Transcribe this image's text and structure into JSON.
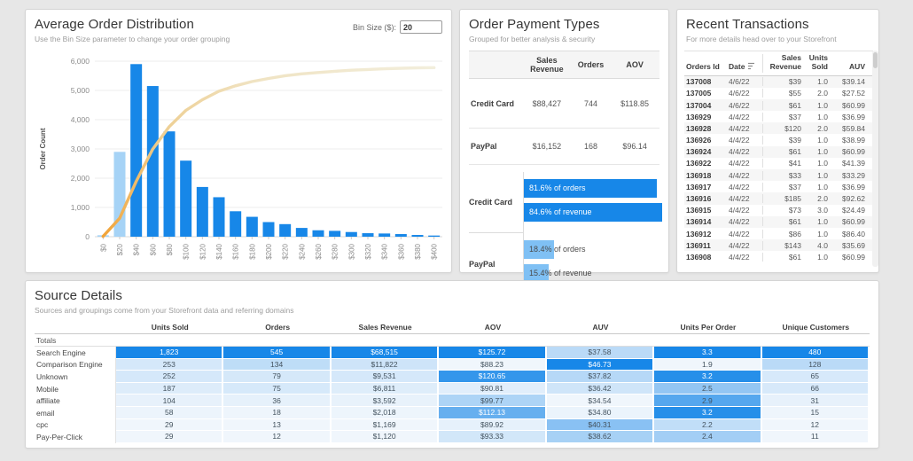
{
  "colors": {
    "bar_blue": "#1787e8",
    "bar_blue_light": "#a6d3f6",
    "paypal_blue": "#7fc0f4",
    "heat_low": "#f0f6fc",
    "heat_high": "#1787e8",
    "line_gradient": [
      "#f1a338",
      "#eecf93",
      "#f0e3c2",
      "#f2eedc"
    ]
  },
  "chart_data": [
    {
      "type": "bar",
      "subtype": "pareto-histogram-with-cumulative-line",
      "title": "Average Order Distribution",
      "ylabel": "Order Count",
      "ylim": [
        0,
        6000
      ],
      "y_ticks": [
        "0",
        "1,000",
        "2,000",
        "3,000",
        "4,000",
        "5,000",
        "6,000"
      ],
      "categories": [
        "$0",
        "$20",
        "$40",
        "$60",
        "$80",
        "$100",
        "$120",
        "$140",
        "$160",
        "$180",
        "$200",
        "$220",
        "$240",
        "$260",
        "$280",
        "$300",
        "$320",
        "$340",
        "$360",
        "$380",
        "$400"
      ],
      "values": [
        50,
        2900,
        5900,
        5150,
        3600,
        2600,
        1700,
        1350,
        870,
        680,
        500,
        430,
        300,
        220,
        200,
        160,
        120,
        110,
        90,
        60,
        40
      ],
      "light_bins": [
        0,
        20
      ],
      "line": {
        "name": "cumulative share of orders",
        "scaling": "cumulative fraction of total mapped to left axis",
        "max_left_axis_value": 5780
      },
      "grid": "horizontal"
    },
    {
      "type": "bar",
      "title": "Order Payment Types share",
      "categories": [
        "Credit Card % of orders",
        "Credit Card % of revenue",
        "PayPal % of orders",
        "PayPal % of revenue"
      ],
      "values": [
        81.6,
        84.6,
        18.4,
        15.4
      ],
      "xlim": [
        0,
        100
      ],
      "legend_position": "none"
    }
  ],
  "order_distribution": {
    "title": "Average Order Distribution",
    "subtitle": "Use the Bin Size parameter to change your order grouping",
    "bin_label": "Bin Size ($):",
    "bin_value": "20",
    "ylabel": "Order Count"
  },
  "payment_types": {
    "title": "Order Payment Types",
    "subtitle": "Grouped for better analysis & security",
    "columns": [
      "Sales Revenue",
      "Orders",
      "AOV"
    ],
    "rows": [
      {
        "label": "Credit Card",
        "cells": [
          "$88,427",
          "744",
          "$118.85"
        ]
      },
      {
        "label": "PayPal",
        "cells": [
          "$16,152",
          "168",
          "$96.14"
        ]
      }
    ],
    "share_groups": [
      {
        "label": "Credit Card",
        "dark": true,
        "bars": [
          {
            "pct": 81.6,
            "text": "81.6% of orders"
          },
          {
            "pct": 84.6,
            "text": "84.6% of revenue"
          }
        ]
      },
      {
        "label": "PayPal",
        "dark": false,
        "bars": [
          {
            "pct": 18.4,
            "text": "18.4% of orders"
          },
          {
            "pct": 15.4,
            "text": "15.4% of revenue"
          }
        ]
      }
    ]
  },
  "transactions": {
    "title": "Recent Transactions",
    "subtitle": "For more details head over to your Storefront",
    "columns": [
      "Orders Id",
      "Date",
      "Sales Revenue",
      "Units Sold",
      "AUV"
    ],
    "sorted_column": "Date",
    "rows": [
      [
        "137008",
        "4/6/22",
        "$39",
        "1.0",
        "$39.14"
      ],
      [
        "137005",
        "4/6/22",
        "$55",
        "2.0",
        "$27.52"
      ],
      [
        "137004",
        "4/6/22",
        "$61",
        "1.0",
        "$60.99"
      ],
      [
        "136929",
        "4/4/22",
        "$37",
        "1.0",
        "$36.99"
      ],
      [
        "136928",
        "4/4/22",
        "$120",
        "2.0",
        "$59.84"
      ],
      [
        "136926",
        "4/4/22",
        "$39",
        "1.0",
        "$38.99"
      ],
      [
        "136924",
        "4/4/22",
        "$61",
        "1.0",
        "$60.99"
      ],
      [
        "136922",
        "4/4/22",
        "$41",
        "1.0",
        "$41.39"
      ],
      [
        "136918",
        "4/4/22",
        "$33",
        "1.0",
        "$33.29"
      ],
      [
        "136917",
        "4/4/22",
        "$37",
        "1.0",
        "$36.99"
      ],
      [
        "136916",
        "4/4/22",
        "$185",
        "2.0",
        "$92.62"
      ],
      [
        "136915",
        "4/4/22",
        "$73",
        "3.0",
        "$24.49"
      ],
      [
        "136914",
        "4/4/22",
        "$61",
        "1.0",
        "$60.99"
      ],
      [
        "136912",
        "4/4/22",
        "$86",
        "1.0",
        "$86.40"
      ],
      [
        "136911",
        "4/4/22",
        "$143",
        "4.0",
        "$35.69"
      ],
      [
        "136908",
        "4/4/22",
        "$61",
        "1.0",
        "$60.99"
      ]
    ]
  },
  "source_details": {
    "title": "Source Details",
    "subtitle": "Sources and groupings come from your Storefront data and referring domains",
    "columns": [
      "Units Sold",
      "Orders",
      "Sales Revenue",
      "AOV",
      "AUV",
      "Units Per Order",
      "Unique Customers"
    ],
    "totals_label": "Totals",
    "rows": [
      {
        "label": "Search Engine",
        "cells": [
          "1,823",
          "545",
          "$68,515",
          "$125.72",
          "$37.58",
          "3.3",
          "480"
        ],
        "white": [
          0,
          1,
          2,
          3,
          5,
          6
        ]
      },
      {
        "label": "Comparison Engine",
        "cells": [
          "253",
          "134",
          "$11,822",
          "$88.23",
          "$46.73",
          "1.9",
          "128"
        ],
        "white": [
          4
        ]
      },
      {
        "label": "Unknown",
        "cells": [
          "252",
          "79",
          "$9,531",
          "$120.65",
          "$37.82",
          "3.2",
          "65"
        ],
        "white": [
          3,
          5
        ]
      },
      {
        "label": "Mobile",
        "cells": [
          "187",
          "75",
          "$6,811",
          "$90.81",
          "$36.42",
          "2.5",
          "66"
        ],
        "white": []
      },
      {
        "label": "affiliate",
        "cells": [
          "104",
          "36",
          "$3,592",
          "$99.77",
          "$34.54",
          "2.9",
          "31"
        ],
        "white": []
      },
      {
        "label": "email",
        "cells": [
          "58",
          "18",
          "$2,018",
          "$112.13",
          "$34.80",
          "3.2",
          "15"
        ],
        "white": [
          3,
          5
        ]
      },
      {
        "label": "cpc",
        "cells": [
          "29",
          "13",
          "$1,169",
          "$89.92",
          "$40.31",
          "2.2",
          "12"
        ],
        "white": []
      },
      {
        "label": "Pay-Per-Click",
        "cells": [
          "29",
          "12",
          "$1,120",
          "$93.33",
          "$38.62",
          "2.4",
          "11"
        ],
        "white": []
      }
    ]
  }
}
